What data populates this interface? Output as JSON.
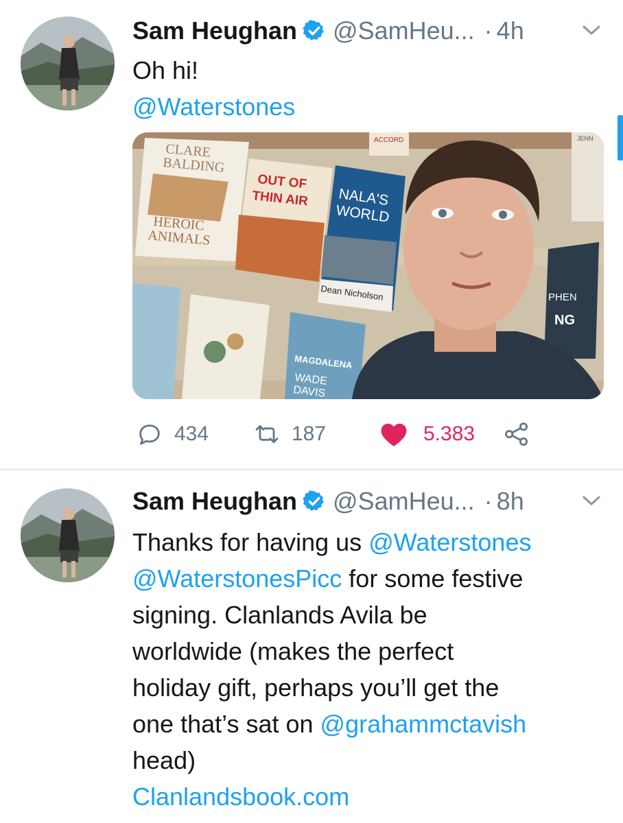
{
  "tweets": [
    {
      "author_name": "Sam Heughan",
      "handle": "@SamHeu...",
      "separator": "·",
      "time": "4h",
      "text_line": "Oh hi!",
      "mention": "@Waterstones",
      "media": {
        "book_titles": [
          "CLARE",
          "BALDING",
          "HEROIC",
          "ANIMALS",
          "OUT OF",
          "THIN AIR",
          "NALA'S",
          "WORLD",
          "Dean Nicholson",
          "MAGDALENA",
          "WADE",
          "DAVIS",
          "PHEN",
          "NG",
          "ACCORD",
          "JENN"
        ]
      },
      "stats": {
        "replies": "434",
        "retweets": "187",
        "likes": "5.383"
      }
    },
    {
      "author_name": "Sam Heughan",
      "handle": "@SamHeu...",
      "separator": "·",
      "time": "8h",
      "line1_text": "Thanks for having us ",
      "line1_mention": "@Waterstones",
      "line2_mention": "@WaterstonesPicc",
      "line2_text": " for some festive",
      "line3": "signing. Clanlands Avila be",
      "line4": "worldwide (makes the perfect",
      "line5": "holiday gift, perhaps you’ll get the",
      "line6_text": "one that’s sat on ",
      "line6_mention": "@grahammctavish",
      "line7": "head)",
      "link": "Clanlandsbook.com"
    }
  ],
  "icons": {
    "verified": "verified-badge-icon",
    "caret": "chevron-down-icon",
    "reply": "reply-icon",
    "retweet": "retweet-icon",
    "like": "heart-icon",
    "share": "share-icon"
  },
  "colors": {
    "accent": "#1da1f2",
    "like": "#e0245e",
    "muted": "#657786",
    "text": "#14171a"
  }
}
